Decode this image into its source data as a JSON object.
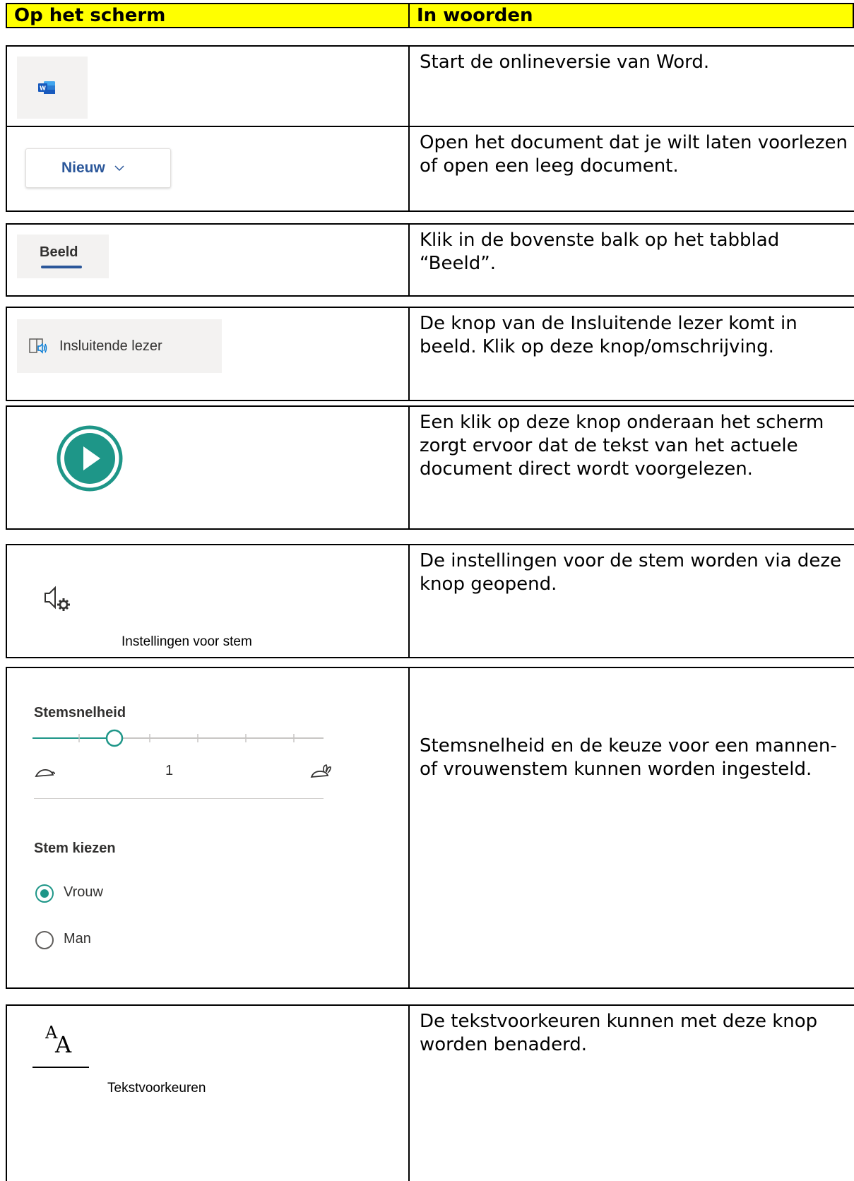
{
  "header": {
    "col_left": "Op het scherm",
    "col_right": "In woorden"
  },
  "rows": [
    {
      "icon": "word-app-icon",
      "description": "Start de onlineversie van Word."
    },
    {
      "button_label": "Nieuw",
      "icon": "chevron-down-icon",
      "description": "Open het document dat je wilt laten voorlezen of open een leeg document."
    },
    {
      "tab_label": "Beeld",
      "description": "Klik in de bovenste balk op het tabblad “Beeld”."
    },
    {
      "button_label": "Insluitende lezer",
      "icon": "immersive-reader-icon",
      "description": "De knop van de Insluitende lezer komt in beeld. Klik op deze knop/omschrijving."
    },
    {
      "icon": "play-icon",
      "description": "Een klik op deze knop onderaan het scherm zorgt ervoor dat de tekst van het actuele document direct wordt voorgelezen."
    },
    {
      "icon": "voice-settings-icon",
      "caption": "Instellingen voor stem",
      "description": "De instellingen voor de stem worden via deze knop geopend."
    },
    {
      "speed_title": "Stemsnelheid",
      "speed_value": "1",
      "speed_level_fraction": 0.25,
      "choose_title": "Stem kiezen",
      "options": [
        "Vrouw",
        "Man"
      ],
      "selected": "Vrouw",
      "description": "Stemsnelheid en de keuze voor een mannen- of vrouwenstem kunnen worden ingesteld."
    },
    {
      "icon": "text-preferences-icon",
      "caption": "Tekstvoorkeuren",
      "description": "De tekstvoorkeuren kunnen met deze knop worden benaderd."
    }
  ],
  "colors": {
    "header_bg": "#ffff00",
    "word_blue": "#2b579a",
    "accent_teal": "#1e9688"
  }
}
